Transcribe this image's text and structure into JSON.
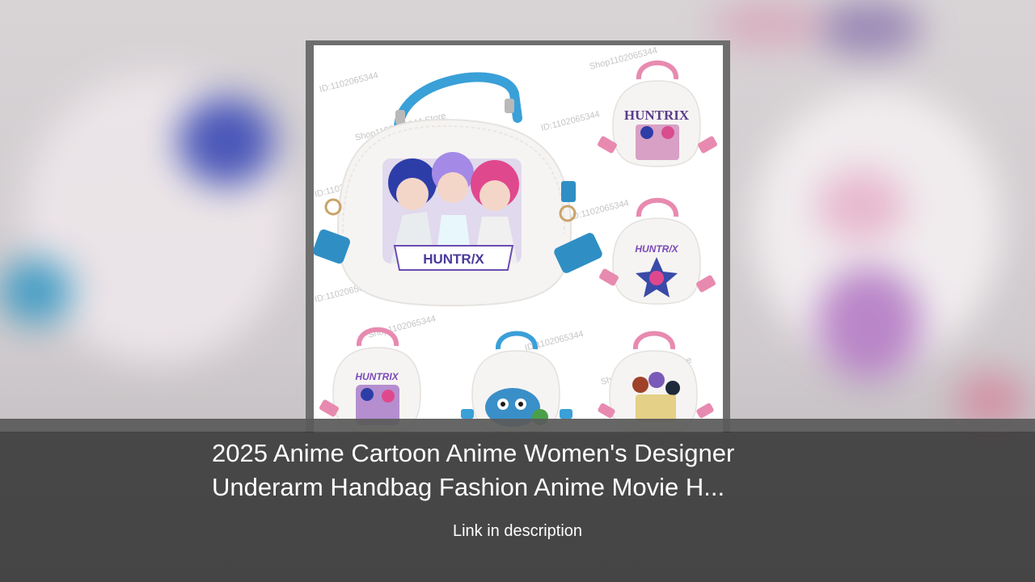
{
  "product": {
    "brand_text": "HUNTR/X",
    "brand_text_variant": "HUNTRIX",
    "watermark_id": "ID:1102065344",
    "watermark_store": "Shop1102065344 Store",
    "watermark_short": "Shop1102065344"
  },
  "caption": {
    "title_line1": "2025 Anime Cartoon Anime Women's Designer",
    "title_line2": "Underarm Handbag Fashion Anime Movie H...",
    "subtitle": "Link in description"
  },
  "colors": {
    "overlay": "#303030",
    "handle_blue": "#3aa0d8",
    "handle_pink": "#e88ab0",
    "bag_body": "#f6f4f2"
  }
}
